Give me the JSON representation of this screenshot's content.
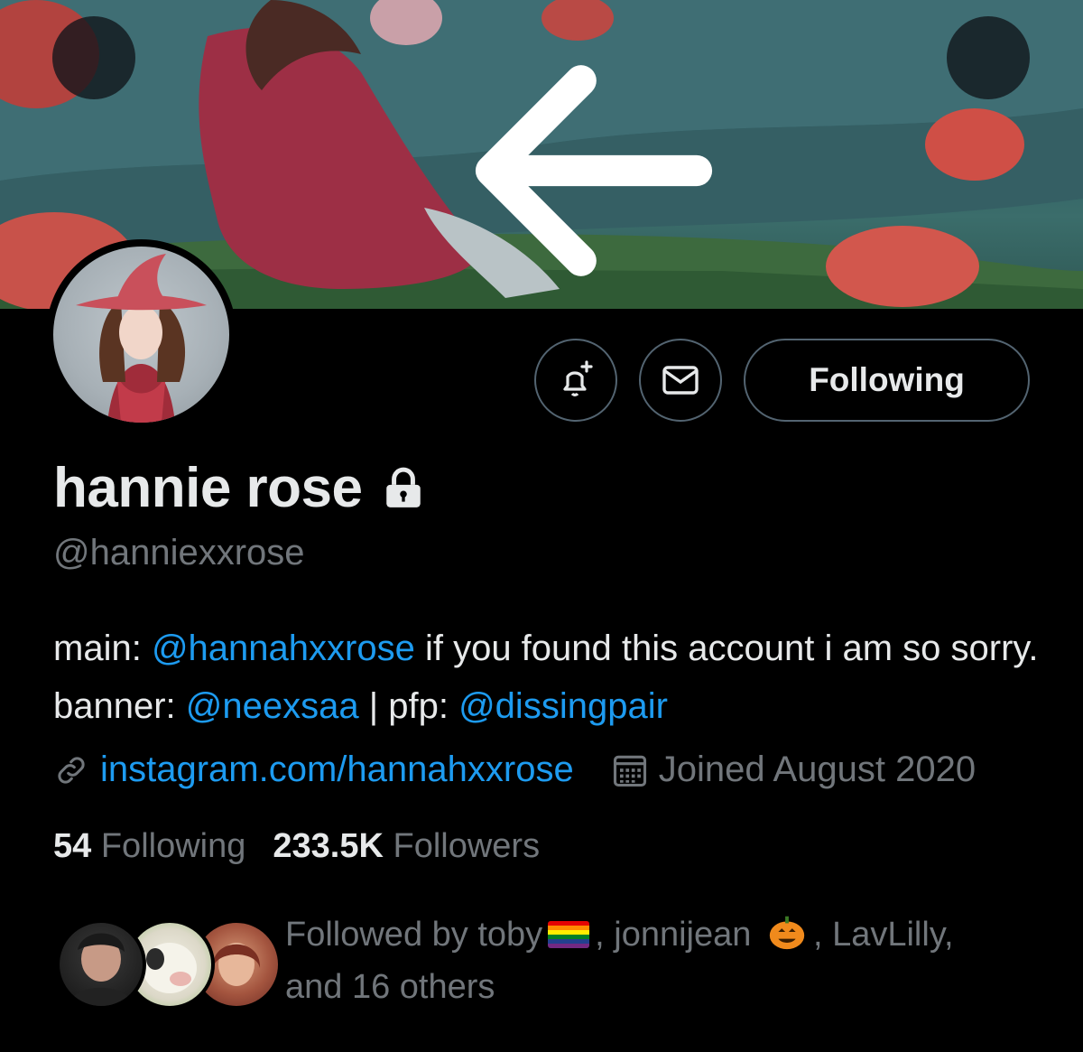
{
  "profile": {
    "display_name": "hannie rose",
    "handle": "@hanniexxrose",
    "bio": {
      "prefix": "main: ",
      "mention_main": "@hannahxxrose",
      "middle": " if you found this account i am so sorry. banner: ",
      "mention_banner": "@neexsaa",
      "separator": " | pfp: ",
      "mention_pfp": "@dissingpair"
    },
    "website": "instagram.com/hannahxxrose",
    "joined": "Joined August 2020"
  },
  "actions": {
    "following_label": "Following"
  },
  "stats": {
    "following_count": "54",
    "following_label": "Following",
    "followers_count": "233.5K",
    "followers_label": "Followers"
  },
  "followed_by": {
    "prefix": "Followed by toby",
    "second": ", jonnijean",
    "third": ", LavLilly,",
    "rest": "and 16 others"
  },
  "icons": {
    "back": "arrow-left-icon",
    "more": "more-horizontal-icon",
    "notify": "bell-plus-icon",
    "message": "mail-icon",
    "protected": "lock-icon",
    "link": "link-icon",
    "calendar": "calendar-icon"
  },
  "colors": {
    "accent": "#1d9bf0",
    "secondary_text": "#71767b",
    "primary_text": "#e7e9ea",
    "border": "#536471"
  }
}
